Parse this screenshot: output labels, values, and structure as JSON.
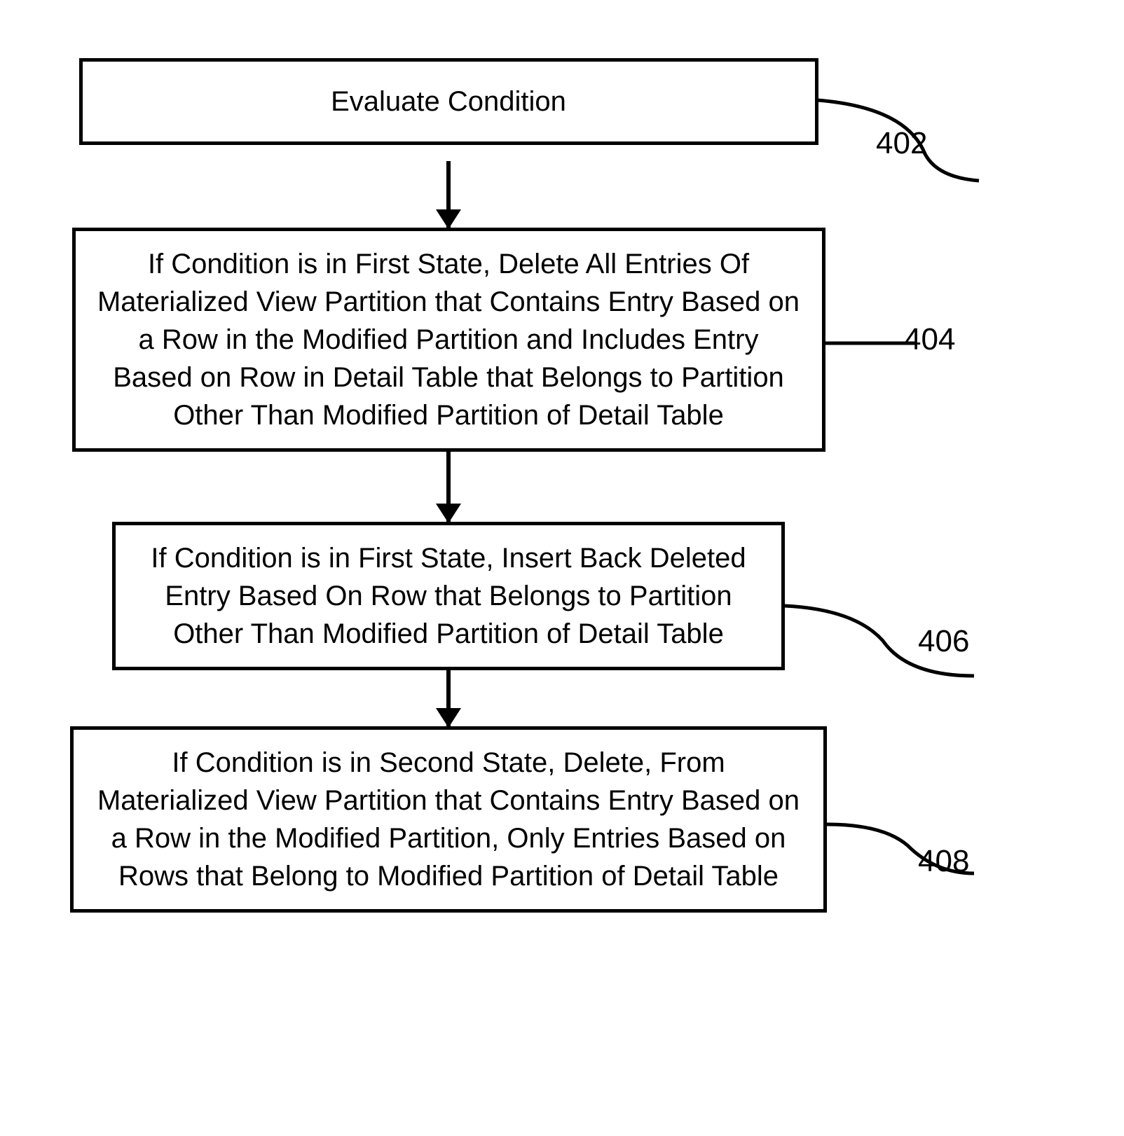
{
  "flowchart": {
    "steps": [
      {
        "text": "Evaluate Condition",
        "label": "402"
      },
      {
        "text": "If Condition is in First State, Delete All Entries Of Materialized View Partition that Contains Entry Based on a Row in the Modified Partition and Includes Entry Based on Row in Detail Table that Belongs to Partition Other Than Modified Partition of Detail Table",
        "label": "404"
      },
      {
        "text": "If Condition is in First State, Insert Back Deleted Entry Based On Row that Belongs to Partition Other Than Modified Partition of Detail Table",
        "label": "406"
      },
      {
        "text": "If Condition is in Second State, Delete, From Materialized View Partition that Contains Entry Based on a Row in the Modified Partition, Only Entries Based on Rows that Belong to Modified Partition of Detail Table",
        "label": "408"
      }
    ]
  }
}
